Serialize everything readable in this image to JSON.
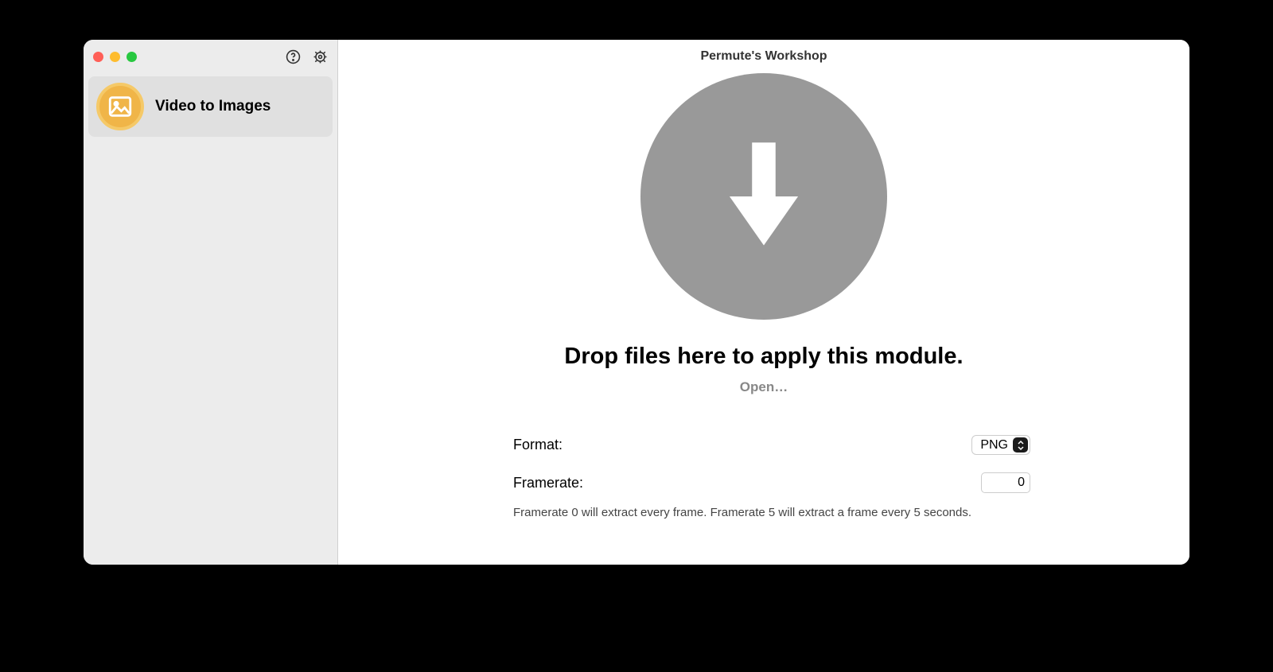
{
  "window": {
    "title": "Permute's Workshop"
  },
  "sidebar": {
    "items": [
      {
        "label": "Video to Images"
      }
    ]
  },
  "dropzone": {
    "title": "Drop files here to apply this module.",
    "open_label": "Open…"
  },
  "options": {
    "format_label": "Format:",
    "format_value": "PNG",
    "framerate_label": "Framerate:",
    "framerate_value": "0",
    "framerate_help": "Framerate 0 will extract every frame. Framerate 5 will extract a frame every 5 seconds."
  }
}
